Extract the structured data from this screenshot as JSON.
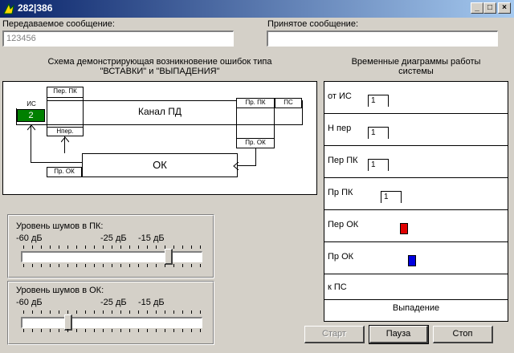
{
  "window": {
    "title": "282|386",
    "minimize_glyph": "_",
    "maximize_glyph": "□",
    "close_glyph": "×"
  },
  "sent": {
    "label": "Передаваемое сообщение:",
    "value": "123456"
  },
  "received": {
    "label": "Принятое сообщение:",
    "value": ""
  },
  "diagram": {
    "caption_line1": "Схема демонстрирующая возникновение ошибок типа",
    "caption_line2": "\"ВСТАВКИ\" и \"ВЫПАДЕНИЯ\"",
    "source_label": "ИС",
    "source_value": "2",
    "tx_label": "Пер. ПК",
    "n_label": "Нпер.",
    "channel_label": "Канал ПД",
    "rx_label": "Пр. ПК",
    "sink_label": "ПС",
    "rx_ok_label": "Пр. ОК",
    "ok_label": "ОК",
    "tx_ok_label": "Пр. ОК"
  },
  "timing": {
    "caption_line1": "Временные диаграммы работы",
    "caption_line2": "системы",
    "rows": [
      {
        "label": "от ИС",
        "pulse": "1"
      },
      {
        "label": "Н пер",
        "pulse": "1"
      },
      {
        "label": "Пер ПК",
        "pulse": "1"
      },
      {
        "label": "Пр ПК",
        "pulse": "1"
      },
      {
        "label": "Пер ОК",
        "marker_color": "#e00000"
      },
      {
        "label": "Пр ОК",
        "marker_color": "#0000e0"
      },
      {
        "label": "к ПС"
      }
    ],
    "status": "Выпадение"
  },
  "noise_pk": {
    "label": "Уровень шумов в ПК:",
    "tick_left": "-60 дБ",
    "tick_mid": "-25 дБ",
    "tick_right": "-15 дБ",
    "level_fraction": 0.83
  },
  "noise_ok": {
    "label": "Уровень шумов в ОК:",
    "tick_left": "-60 дБ",
    "tick_mid": "-25 дБ",
    "tick_right": "-15 дБ",
    "level_fraction": 0.25
  },
  "buttons": {
    "start": "Старт",
    "pause": "Пауза",
    "stop": "Стоп"
  }
}
